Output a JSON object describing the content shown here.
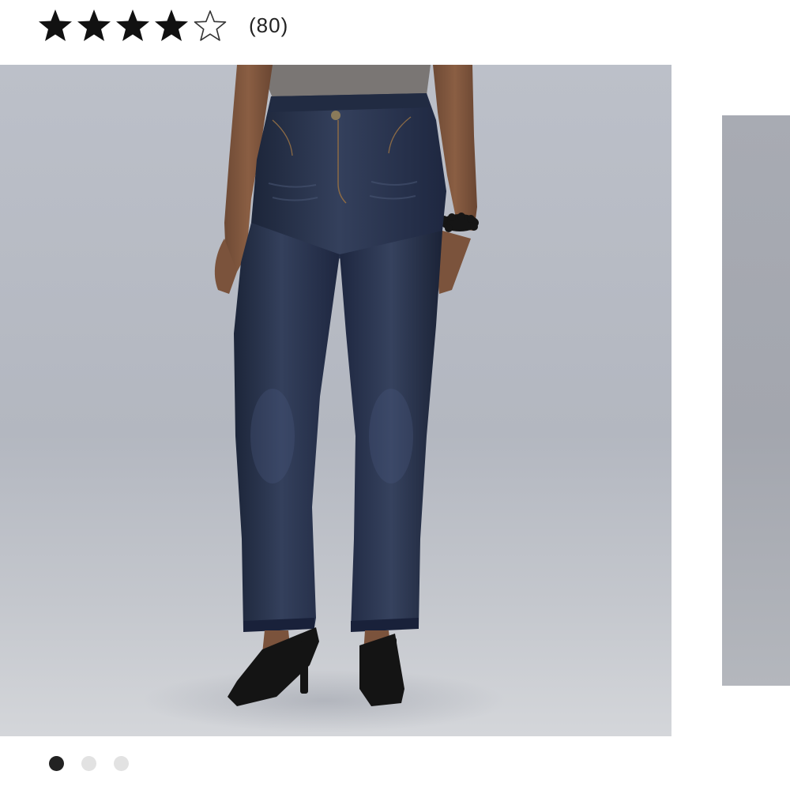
{
  "rating": {
    "value": 4,
    "max": 5,
    "review_count": "(80)",
    "star_icons": [
      "star-filled-icon",
      "star-filled-icon",
      "star-filled-icon",
      "star-filled-icon",
      "star-outline-icon"
    ]
  },
  "carousel": {
    "total_slides": 3,
    "active_slide": 1
  },
  "colors": {
    "star_fill": "#111111",
    "active_dot": "#222222",
    "inactive_dot": "#e2e2e2",
    "photo_background": "#b6bac3",
    "denim": "#25304a"
  }
}
